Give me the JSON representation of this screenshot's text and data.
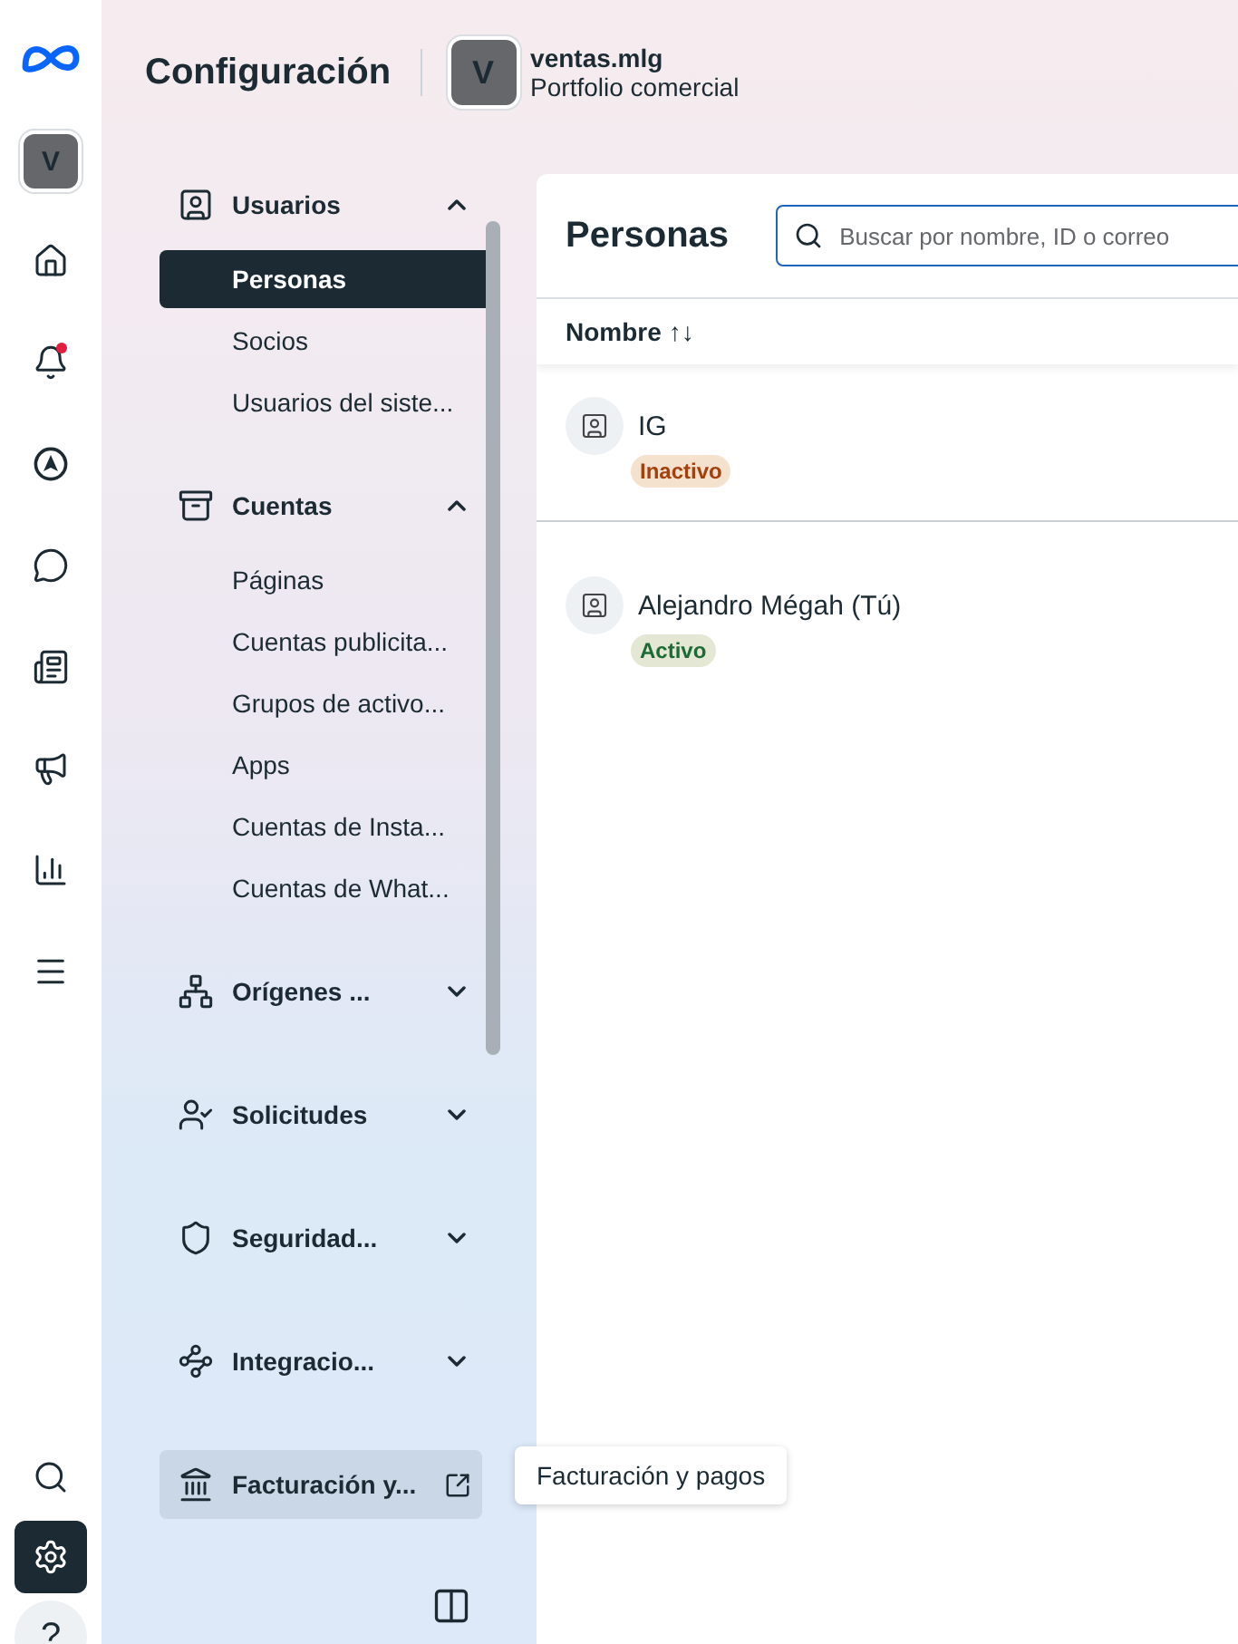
{
  "rail": {
    "account_initial": "V",
    "top_items": [
      {
        "kind": "home",
        "selected": false,
        "notification": false
      },
      {
        "kind": "bell",
        "selected": false,
        "notification": true
      },
      {
        "kind": "navigate",
        "selected": false,
        "notification": false
      },
      {
        "kind": "chat",
        "selected": false,
        "notification": false
      },
      {
        "kind": "feed",
        "selected": false,
        "notification": false
      },
      {
        "kind": "megaphone",
        "selected": false,
        "notification": false
      },
      {
        "kind": "chart",
        "selected": false,
        "notification": false
      },
      {
        "kind": "menu",
        "selected": false,
        "notification": false
      }
    ],
    "bottom_items": [
      {
        "kind": "search",
        "selected": false,
        "notification": false
      },
      {
        "kind": "settings",
        "selected": true,
        "notification": false
      },
      {
        "kind": "help",
        "selected": false,
        "notification": false
      }
    ],
    "help_text": "?"
  },
  "header": {
    "title": "Configuración",
    "portfolio": {
      "initial": "V",
      "name": "ventas.mlg",
      "subtitle": "Portfolio comercial"
    }
  },
  "sidebar": {
    "sections": [
      {
        "kind": "users",
        "label": "Usuarios",
        "expanded": true,
        "children": [
          {
            "label": "Personas",
            "selected": true
          },
          {
            "label": "Socios",
            "selected": false
          },
          {
            "label": "Usuarios del siste...",
            "selected": false
          }
        ]
      },
      {
        "kind": "accounts",
        "label": "Cuentas",
        "expanded": true,
        "children": [
          {
            "label": "Páginas",
            "selected": false
          },
          {
            "label": "Cuentas publicita...",
            "selected": false
          },
          {
            "label": "Grupos de activo...",
            "selected": false
          },
          {
            "label": "Apps",
            "selected": false
          },
          {
            "label": "Cuentas de Insta...",
            "selected": false
          },
          {
            "label": "Cuentas de What...",
            "selected": false
          }
        ]
      },
      {
        "kind": "sources",
        "label": "Orígenes ...",
        "expanded": false
      },
      {
        "kind": "requests",
        "label": "Solicitudes",
        "expanded": false
      },
      {
        "kind": "security",
        "label": "Seguridad...",
        "expanded": false
      },
      {
        "kind": "integrations",
        "label": "Integracio...",
        "expanded": false
      },
      {
        "kind": "billing",
        "label": "Facturación y...",
        "external": true,
        "hovered": true
      }
    ],
    "tooltip": "Facturación y pagos"
  },
  "main": {
    "title": "Personas",
    "search": {
      "placeholder": "Buscar por nombre, ID o correo"
    },
    "column": {
      "label": "Nombre",
      "sort": "↑↓"
    },
    "rows": [
      {
        "name": "IG",
        "color": "#a3400e",
        "status_label": "Inactivo"
      },
      {
        "name": "Alejandro Mégah (Tú)",
        "color": "#1c6b35",
        "status_label": "Activo"
      }
    ]
  }
}
